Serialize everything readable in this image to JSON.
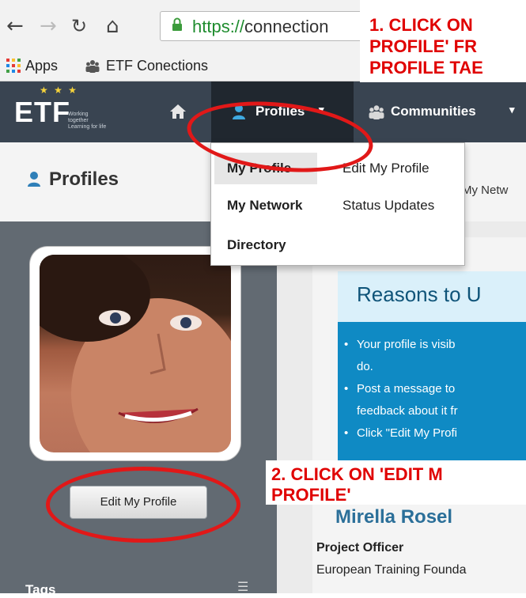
{
  "browser": {
    "url_scheme": "https://",
    "url_rest": "connection",
    "bookmarks": [
      "Apps",
      "ETF Conections"
    ]
  },
  "header": {
    "logo_text": "ETF",
    "logo_tagline": "Working together Learning for life",
    "nav": {
      "profiles": "Profiles",
      "communities": "Communities"
    }
  },
  "page": {
    "title": "Profiles",
    "network_tab_partial": "My Netw"
  },
  "dropdown": {
    "items": [
      "My Profile",
      "Edit My Profile",
      "My Network",
      "Status Updates",
      "Directory"
    ]
  },
  "sidebar": {
    "edit_button": "Edit My Profile",
    "tags_label": "Tags"
  },
  "reasons": {
    "title": "Reasons to U",
    "lines": [
      "Your profile is visib",
      "do.",
      "Post a message to",
      "feedback about it fr",
      "Click \"Edit My Profi"
    ]
  },
  "profile": {
    "name_partial": "Mirella Rosel",
    "job_title": "Project Officer",
    "org": "European Training Founda"
  },
  "annotations": {
    "step1": [
      "1. CLICK ON",
      "PROFILE' FR",
      "PROFILE TAE"
    ],
    "step2": [
      "2. CLICK ON 'EDIT M",
      "PROFILE'"
    ]
  },
  "colors": {
    "header_bg": "#394451",
    "annotation_red": "#e00000",
    "reasons_blue": "#0f8ac4"
  }
}
